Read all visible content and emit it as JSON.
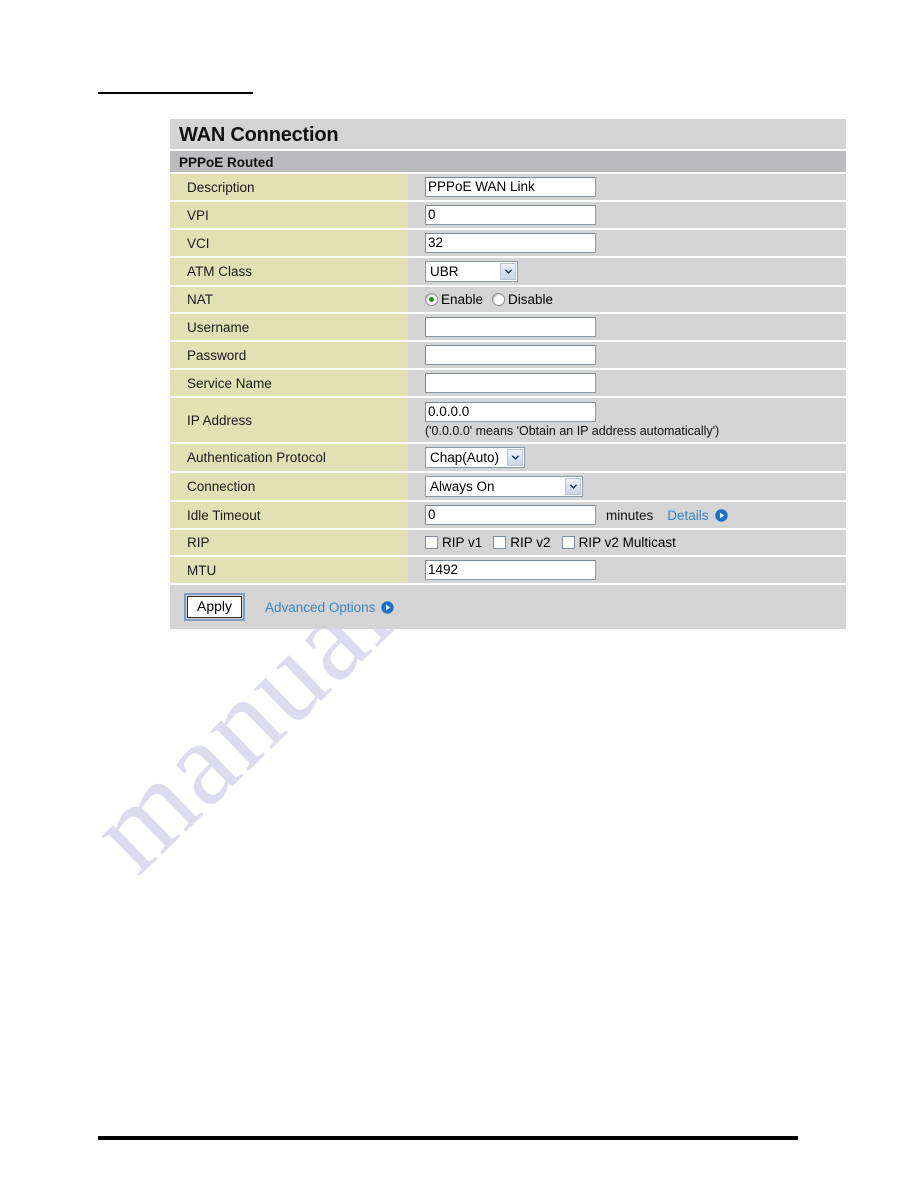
{
  "page": {
    "watermark_text": "manualshive.com"
  },
  "panel": {
    "title": "WAN Connection",
    "subtitle": "PPPoE Routed",
    "rows": [
      {
        "label": "Description",
        "value": "PPPoE WAN Link"
      },
      {
        "label": "VPI",
        "value": "0"
      },
      {
        "label": "VCI",
        "value": "32"
      },
      {
        "label": "ATM Class",
        "value": "UBR"
      },
      {
        "label": "NAT",
        "enable_label": "Enable",
        "disable_label": "Disable",
        "selected": "Enable"
      },
      {
        "label": "Username",
        "value": ""
      },
      {
        "label": "Password",
        "value": ""
      },
      {
        "label": "Service Name",
        "value": ""
      },
      {
        "label": "IP Address",
        "value": "0.0.0.0",
        "hint": "('0.0.0.0' means 'Obtain an IP address automatically')"
      },
      {
        "label": "Authentication Protocol",
        "value": "Chap(Auto)"
      },
      {
        "label": "Connection",
        "value": "Always On"
      },
      {
        "label": "Idle Timeout",
        "value": "0",
        "unit": "minutes",
        "link": "Details"
      },
      {
        "label": "RIP",
        "checkboxes": [
          {
            "label": "RIP v1",
            "checked": false
          },
          {
            "label": "RIP v2",
            "checked": false
          },
          {
            "label": "RIP v2 Multicast",
            "checked": false
          }
        ]
      },
      {
        "label": "MTU",
        "value": "1492"
      }
    ],
    "footer": {
      "apply_label": "Apply",
      "advanced_label": "Advanced Options"
    }
  },
  "colors": {
    "label_bg": "#e2e0b4",
    "row_bg": "#d4d4d4",
    "subtitle_bg": "#bcbcbe",
    "link": "#3a85c8",
    "radio_on": "#1a8f1a",
    "watermark": "#7678be"
  }
}
